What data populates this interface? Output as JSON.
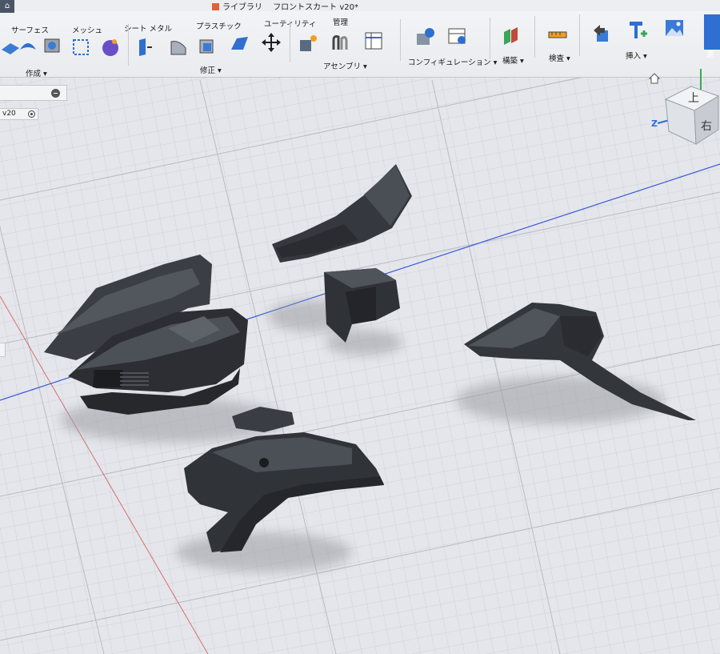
{
  "toolbar": {
    "home_icon": "home-icon",
    "document_title": "フロントスカート v20*",
    "library_label": "ライブラリ",
    "tabs": [
      "サーフェス",
      "メッシュ",
      "シート メタル",
      "プラスチック",
      "ユーティリティ",
      "管理"
    ],
    "menus": {
      "create": "作成 ▾",
      "modify": "修正 ▾",
      "assemble": "アセンブリ ▾",
      "configure": "コンフィギュレーション ▾",
      "construct": "構築 ▾",
      "inspect": "検査 ▾",
      "insert": "挿入 ▾",
      "select": "選"
    }
  },
  "browser": {
    "version_label": "v20"
  },
  "viewcube": {
    "top_face": "上",
    "right_face": "右",
    "axis_z": "Z"
  },
  "colors": {
    "grid_background": "#e4e6eb",
    "grid_line": "#c7cad0",
    "grid_major": "#b5b9c0",
    "axis_x": "#3a58d8",
    "axis_red": "#d23c3c",
    "body_dark": "#2b2d31",
    "body_mid": "#3d4046",
    "body_light": "#55595f",
    "shadow": "#9a9ca2",
    "accent_blue": "#2e6fd1"
  }
}
